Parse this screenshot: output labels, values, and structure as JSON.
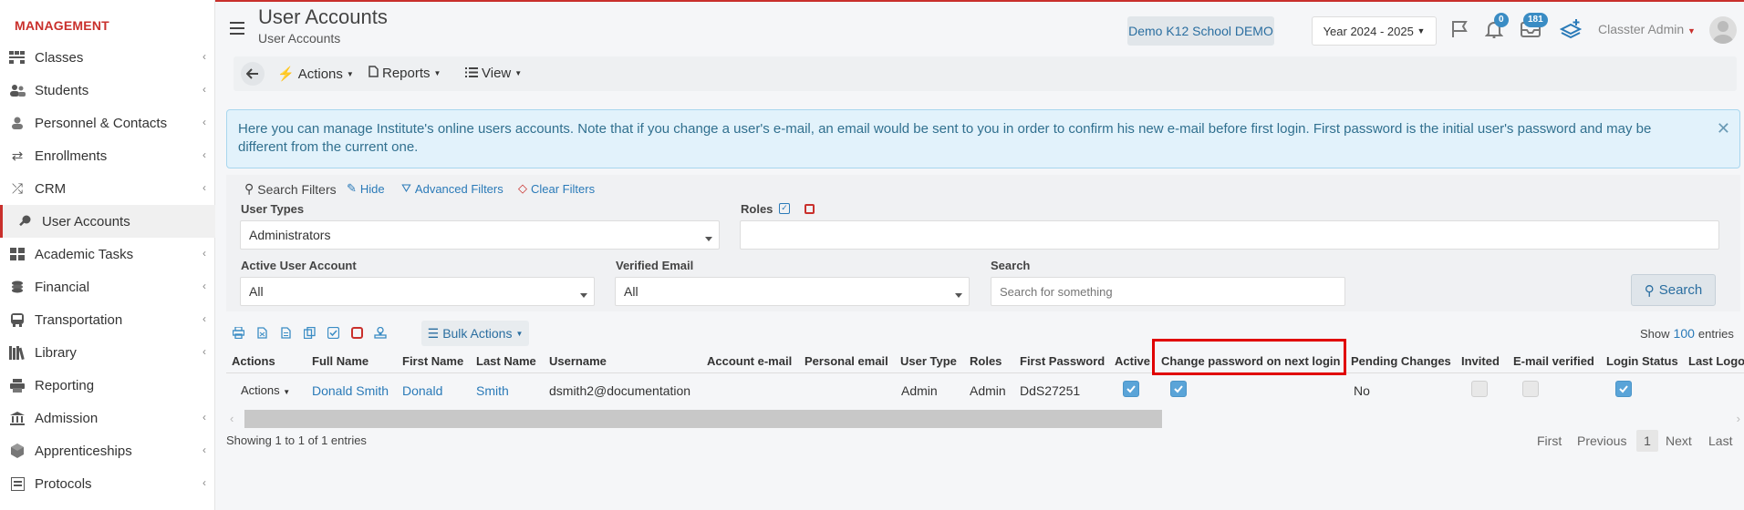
{
  "sidebar": {
    "title": "MANAGEMENT",
    "items": [
      {
        "label": "Classes",
        "icon": "classes-icon"
      },
      {
        "label": "Students",
        "icon": "students-icon"
      },
      {
        "label": "Personnel & Contacts",
        "icon": "personnel-icon"
      },
      {
        "label": "Enrollments",
        "icon": "enrollments-icon"
      },
      {
        "label": "CRM",
        "icon": "crm-icon"
      },
      {
        "label": "User Accounts",
        "icon": "key-icon"
      },
      {
        "label": "Academic Tasks",
        "icon": "academic-tasks-icon"
      },
      {
        "label": "Financial",
        "icon": "financial-icon"
      },
      {
        "label": "Transportation",
        "icon": "bus-icon"
      },
      {
        "label": "Library",
        "icon": "library-icon"
      },
      {
        "label": "Reporting",
        "icon": "reporting-icon"
      },
      {
        "label": "Admission",
        "icon": "admission-icon"
      },
      {
        "label": "Apprenticeships",
        "icon": "apprenticeships-icon"
      },
      {
        "label": "Protocols",
        "icon": "protocols-icon"
      }
    ]
  },
  "header": {
    "title": "User Accounts",
    "subtitle": "User Accounts",
    "school": "Demo K12 School DEMO",
    "year": "Year 2024 - 2025",
    "notifications_count": "0",
    "messages_count": "181",
    "user": "Classter Admin"
  },
  "toolbar": {
    "actions": "Actions",
    "reports": "Reports",
    "view": "View"
  },
  "alert": {
    "text": "Here you can manage Institute's online users accounts. Note that if you change a user's e-mail, an email would be sent to you in order to confirm his new e-mail before first login. First password is the initial user's password and may be different from the current one."
  },
  "filters": {
    "search_filters": "Search Filters",
    "hide": "Hide",
    "advanced": "Advanced Filters",
    "clear": "Clear Filters",
    "user_types_label": "User Types",
    "user_types_value": "Administrators",
    "roles_label": "Roles",
    "active_label": "Active User Account",
    "active_value": "All",
    "verified_label": "Verified Email",
    "verified_value": "All",
    "search_label": "Search",
    "search_placeholder": "Search for something",
    "search_button": "Search"
  },
  "table": {
    "bulk_actions": "Bulk Actions",
    "show_label": "Show",
    "show_count": "100",
    "entries_label": "entries",
    "columns": [
      "Actions",
      "Full Name",
      "First Name",
      "Last Name",
      "Username",
      "Account e-mail",
      "Personal email",
      "User Type",
      "Roles",
      "First Password",
      "Active",
      "Change password on next login",
      "Pending Changes",
      "Invited",
      "E-mail verified",
      "Login Status",
      "Last Logo"
    ],
    "row": {
      "actions": "Actions",
      "full_name": "Donald Smith",
      "first_name": "Donald",
      "last_name": "Smith",
      "username": "dsmith2@documentation",
      "user_type": "Admin",
      "roles": "Admin",
      "first_password": "DdS27251",
      "pending_changes": "No",
      "active": true,
      "change_password": true,
      "invited": false,
      "email_verified": false,
      "login_status": true
    },
    "showing": "Showing 1 to 1 of 1 entries",
    "pager": {
      "first": "First",
      "previous": "Previous",
      "current": "1",
      "next": "Next",
      "last": "Last"
    }
  },
  "colors": {
    "accent": "#c9302c",
    "link": "#2a7ab8",
    "highlight": "#e00000",
    "checkbox": "#5aa4d8"
  }
}
